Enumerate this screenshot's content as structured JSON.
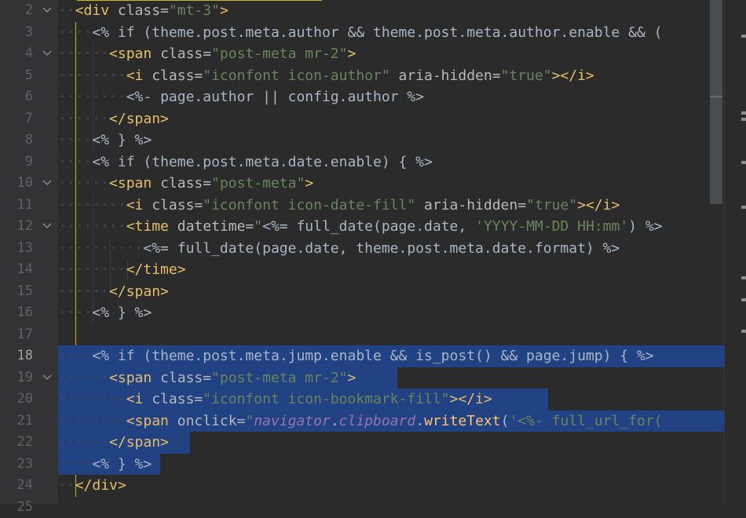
{
  "colors": {
    "background": "#2b2b2b",
    "gutter": "#313335",
    "selection": "#214283",
    "tag": "#e8bf6a",
    "attribute": "#bababa",
    "string": "#6a8759",
    "keyword": "#cc7832",
    "text": "#a9b7c6",
    "instance": "#9876aa",
    "function": "#ffc66d",
    "indent_guide_active": "#c6b832"
  },
  "editor": {
    "current_line": "18",
    "lines": [
      {
        "num": "2",
        "fold": "open",
        "sel": false,
        "tokens": [
          {
            "t": "<div ",
            "c": "tg"
          },
          {
            "t": "class=",
            "c": "at"
          },
          {
            "t": "\"mt-3\"",
            "c": "st"
          },
          {
            "t": ">",
            "c": "tg"
          }
        ]
      },
      {
        "num": "3",
        "sel": false,
        "tokens": [
          {
            "t": "<% ",
            "c": "tx"
          },
          {
            "t": "if ",
            "c": "tx"
          },
          {
            "t": "(theme.post.meta.author && theme.post.meta.author.enable && (",
            "c": "tx"
          }
        ]
      },
      {
        "num": "4",
        "fold": "open",
        "sel": false,
        "tokens": [
          {
            "t": "<span ",
            "c": "tg"
          },
          {
            "t": "class=",
            "c": "at"
          },
          {
            "t": "\"post-meta mr-2\"",
            "c": "st"
          },
          {
            "t": ">",
            "c": "tg"
          }
        ]
      },
      {
        "num": "5",
        "sel": false,
        "tokens": [
          {
            "t": "<i ",
            "c": "tg"
          },
          {
            "t": "class=",
            "c": "at"
          },
          {
            "t": "\"iconfont icon-author\" ",
            "c": "st"
          },
          {
            "t": "aria-hidden=",
            "c": "at"
          },
          {
            "t": "\"true\"",
            "c": "st"
          },
          {
            "t": "></i>",
            "c": "tg"
          }
        ]
      },
      {
        "num": "6",
        "sel": false,
        "tokens": [
          {
            "t": "<%- ",
            "c": "tx"
          },
          {
            "t": "page.author || config.author %>",
            "c": "tx"
          }
        ]
      },
      {
        "num": "7",
        "sel": false,
        "tokens": [
          {
            "t": "</span>",
            "c": "tg"
          }
        ]
      },
      {
        "num": "8",
        "sel": false,
        "tokens": [
          {
            "t": "<% } %>",
            "c": "tx"
          }
        ]
      },
      {
        "num": "9",
        "sel": false,
        "tokens": [
          {
            "t": "<% ",
            "c": "tx"
          },
          {
            "t": "if ",
            "c": "tx"
          },
          {
            "t": "(theme.post.meta.date.enable) { %>",
            "c": "tx"
          }
        ]
      },
      {
        "num": "10",
        "fold": "open",
        "sel": false,
        "tokens": [
          {
            "t": "<span ",
            "c": "tg"
          },
          {
            "t": "class=",
            "c": "at"
          },
          {
            "t": "\"post-meta\"",
            "c": "st"
          },
          {
            "t": ">",
            "c": "tg"
          }
        ]
      },
      {
        "num": "11",
        "sel": false,
        "tokens": [
          {
            "t": "<i ",
            "c": "tg"
          },
          {
            "t": "class=",
            "c": "at"
          },
          {
            "t": "\"iconfont icon-date-fill\" ",
            "c": "st"
          },
          {
            "t": "aria-hidden=",
            "c": "at"
          },
          {
            "t": "\"true\"",
            "c": "st"
          },
          {
            "t": "></i>",
            "c": "tg"
          }
        ]
      },
      {
        "num": "12",
        "fold": "open",
        "sel": false,
        "tokens": [
          {
            "t": "<time ",
            "c": "tg"
          },
          {
            "t": "datetime=",
            "c": "at"
          },
          {
            "t": "\"",
            "c": "st"
          },
          {
            "t": "<%= full_date(page.date, ",
            "c": "tx"
          },
          {
            "t": "'YYYY-MM-DD HH:mm'",
            "c": "st"
          },
          {
            "t": ") %>",
            "c": "tx"
          }
        ]
      },
      {
        "num": "13",
        "sel": false,
        "tokens": [
          {
            "t": "<%= ",
            "c": "tx"
          },
          {
            "t": "full_date(page.date, theme.post.meta.date.format) %>",
            "c": "tx"
          }
        ]
      },
      {
        "num": "14",
        "sel": false,
        "tokens": [
          {
            "t": "</time>",
            "c": "tg"
          }
        ]
      },
      {
        "num": "15",
        "sel": false,
        "tokens": [
          {
            "t": "</span>",
            "c": "tg"
          }
        ]
      },
      {
        "num": "16",
        "sel": false,
        "tokens": [
          {
            "t": "<% } %>",
            "c": "tx"
          }
        ]
      },
      {
        "num": "17",
        "sel": false,
        "tokens": []
      },
      {
        "num": "18",
        "sel": true,
        "tokens": [
          {
            "t": "<% ",
            "c": "tx"
          },
          {
            "t": "if ",
            "c": "tx"
          },
          {
            "t": "(theme.post.meta.jump.enable && is_post() && page.jump) { %>",
            "c": "tx"
          }
        ]
      },
      {
        "num": "19",
        "fold": "open",
        "sel": true,
        "tokens": [
          {
            "t": "<span ",
            "c": "tg"
          },
          {
            "t": "class=",
            "c": "at"
          },
          {
            "t": "\"post-meta mr-2\"",
            "c": "st"
          },
          {
            "t": ">",
            "c": "tg"
          }
        ]
      },
      {
        "num": "20",
        "sel": true,
        "tokens": [
          {
            "t": "<i ",
            "c": "tg"
          },
          {
            "t": "class=",
            "c": "at"
          },
          {
            "t": "\"iconfont icon-bookmark-fill\"",
            "c": "st"
          },
          {
            "t": "></i>",
            "c": "tg"
          }
        ]
      },
      {
        "num": "21",
        "sel": true,
        "tokens": [
          {
            "t": "<span ",
            "c": "tg"
          },
          {
            "t": "onclick=",
            "c": "at"
          },
          {
            "t": "\"",
            "c": "st"
          },
          {
            "t": "navigator",
            "c": "ti"
          },
          {
            "t": ".",
            "c": "tx"
          },
          {
            "t": "clipboard",
            "c": "ti"
          },
          {
            "t": ".",
            "c": "tx"
          },
          {
            "t": "writeText",
            "c": "fn"
          },
          {
            "t": "(",
            "c": "tx"
          },
          {
            "t": "'<%- full_url_for(",
            "c": "st"
          }
        ]
      },
      {
        "num": "22",
        "sel": true,
        "tokens": [
          {
            "t": "</span>",
            "c": "tg"
          }
        ]
      },
      {
        "num": "23",
        "sel": true,
        "tokens": [
          {
            "t": "<% } %>",
            "c": "tx"
          }
        ]
      },
      {
        "num": "24",
        "sel": false,
        "tokens": [
          {
            "t": "</div>",
            "c": "tg"
          }
        ]
      },
      {
        "num": "25",
        "sel": false,
        "tokens": []
      }
    ]
  }
}
